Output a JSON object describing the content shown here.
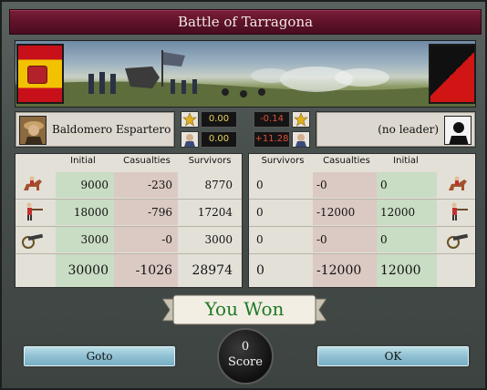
{
  "title": "Battle of Tarragona",
  "left": {
    "leader_name": "Baldomero Espartero",
    "stat_morale": "0.00",
    "stat_defense": "0.00",
    "flag_icon": "spain-flag-icon"
  },
  "right": {
    "leader_name": "(no leader)",
    "stat_morale": "-0.14",
    "stat_defense": "+11.28",
    "flag_icon": "rebel-flag-icon"
  },
  "headers": {
    "initial": "Initial",
    "casualties": "Casualties",
    "survivors": "Survivors"
  },
  "left_rows": [
    {
      "unit": "cavalry-icon",
      "initial": "9000",
      "casualties": "-230",
      "survivors": "8770"
    },
    {
      "unit": "infantry-icon",
      "initial": "18000",
      "casualties": "-796",
      "survivors": "17204"
    },
    {
      "unit": "artillery-icon",
      "initial": "3000",
      "casualties": "-0",
      "survivors": "3000"
    }
  ],
  "left_totals": {
    "initial": "30000",
    "casualties": "-1026",
    "survivors": "28974"
  },
  "right_rows": [
    {
      "unit": "cavalry-icon",
      "survivors": "0",
      "casualties": "-0",
      "initial": "0"
    },
    {
      "unit": "infantry-icon",
      "survivors": "0",
      "casualties": "-12000",
      "initial": "12000"
    },
    {
      "unit": "artillery-icon",
      "survivors": "0",
      "casualties": "-0",
      "initial": "0"
    }
  ],
  "right_totals": {
    "survivors": "0",
    "casualties": "-12000",
    "initial": "12000"
  },
  "result": "You Won",
  "buttons": {
    "goto": "Goto",
    "ok": "OK"
  },
  "score": {
    "value": "0",
    "label": "Score"
  },
  "colors": {
    "title_bar": "#5d1229",
    "result_text": "#1f7a26",
    "button": "#8fc0d2"
  }
}
